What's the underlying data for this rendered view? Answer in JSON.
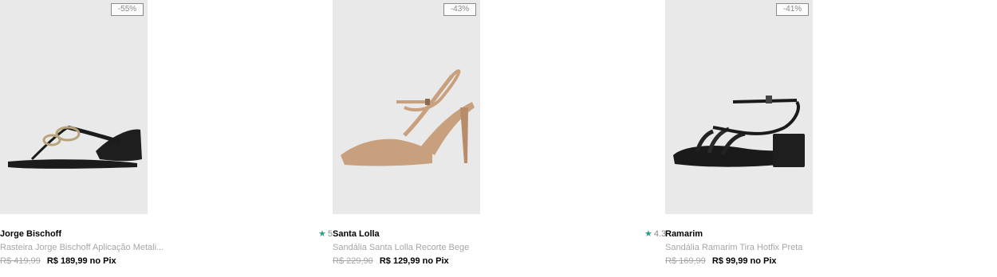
{
  "products": [
    {
      "discount": "-55%",
      "rating": "",
      "brand": "Jorge Bischoff",
      "name": "Rasteira Jorge Bischoff Aplicação Metali...",
      "old_price": "R$ 419,99",
      "price": "R$ 189,99",
      "pix_label": "no Pix",
      "image_icon": "flat-sandal-image"
    },
    {
      "discount": "-43%",
      "rating": "5",
      "brand": "Santa Lolla",
      "name": "Sandália Santa Lolla Recorte Bege",
      "old_price": "R$ 229,90",
      "price": "R$ 129,99",
      "pix_label": "no Pix",
      "image_icon": "heel-sandal-image"
    },
    {
      "discount": "-41%",
      "rating": "4.3",
      "brand": "Ramarim",
      "name": "Sandália Ramarim Tira Hotfix Preta",
      "old_price": "R$ 169,99",
      "price": "R$ 99,99",
      "pix_label": "no Pix",
      "image_icon": "block-heel-sandal-image"
    }
  ],
  "colors": {
    "star": "#2a9d8f",
    "image_bg": "#e9e9e9",
    "muted_text": "#a6a6a6"
  },
  "icons": {
    "star": "star-icon"
  }
}
